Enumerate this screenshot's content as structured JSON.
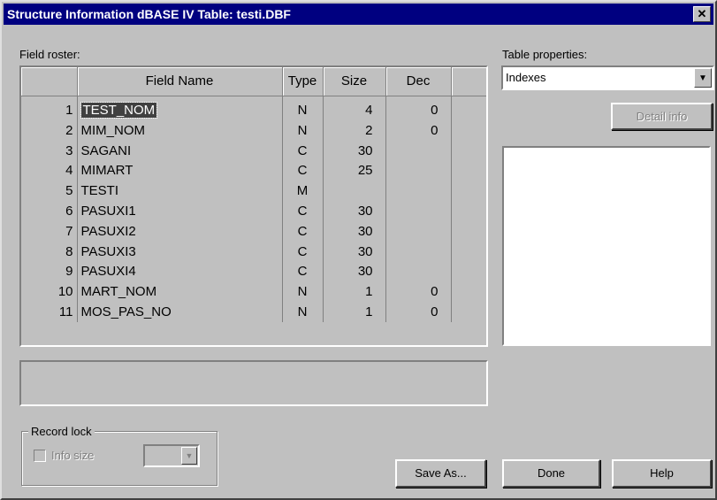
{
  "window": {
    "title": "Structure Information dBASE IV Table: testi.DBF",
    "close_label": "✕"
  },
  "field_roster": {
    "label": "Field roster:",
    "columns": [
      "",
      "Field Name",
      "Type",
      "Size",
      "Dec"
    ],
    "rows": [
      {
        "num": "1",
        "name": "TEST_NOM",
        "type": "N",
        "size": "4",
        "dec": "0"
      },
      {
        "num": "2",
        "name": "MIM_NOM",
        "type": "N",
        "size": "2",
        "dec": "0"
      },
      {
        "num": "3",
        "name": "SAGANI",
        "type": "C",
        "size": "30",
        "dec": ""
      },
      {
        "num": "4",
        "name": "MIMART",
        "type": "C",
        "size": "25",
        "dec": ""
      },
      {
        "num": "5",
        "name": "TESTI",
        "type": "M",
        "size": "",
        "dec": ""
      },
      {
        "num": "6",
        "name": "PASUXI1",
        "type": "C",
        "size": "30",
        "dec": ""
      },
      {
        "num": "7",
        "name": "PASUXI2",
        "type": "C",
        "size": "30",
        "dec": ""
      },
      {
        "num": "8",
        "name": "PASUXI3",
        "type": "C",
        "size": "30",
        "dec": ""
      },
      {
        "num": "9",
        "name": "PASUXI4",
        "type": "C",
        "size": "30",
        "dec": ""
      },
      {
        "num": "10",
        "name": "MART_NOM",
        "type": "N",
        "size": "1",
        "dec": "0"
      },
      {
        "num": "11",
        "name": "MOS_PAS_NO",
        "type": "N",
        "size": "1",
        "dec": "0"
      }
    ]
  },
  "record_lock": {
    "group_label": "Record lock",
    "info_size_label": "Info size",
    "arrow_icon": "▼"
  },
  "table_properties": {
    "label": "Table properties:",
    "selected": "Indexes",
    "arrow_icon": "▼",
    "detail_info_label": "Detail info"
  },
  "buttons": {
    "save_as": "Save As...",
    "done": "Done",
    "help": "Help"
  },
  "colors": {
    "title_bar": "#000080",
    "face": "#c0c0c0",
    "selection": "#404040"
  }
}
